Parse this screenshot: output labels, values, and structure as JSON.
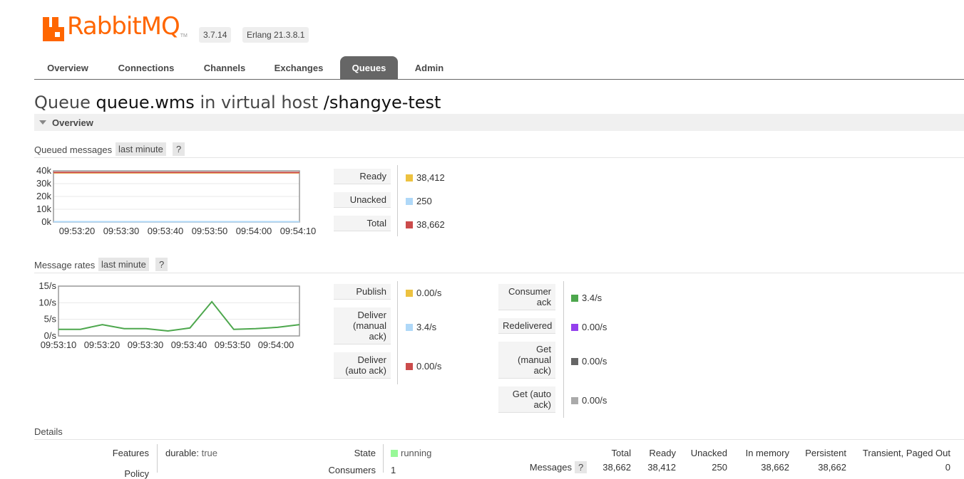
{
  "header": {
    "logo_text": "RabbitMQ",
    "logo_tm": "TM",
    "version": "3.7.14",
    "erlang": "Erlang 21.3.8.1"
  },
  "tabs": [
    {
      "label": "Overview",
      "active": false
    },
    {
      "label": "Connections",
      "active": false
    },
    {
      "label": "Channels",
      "active": false
    },
    {
      "label": "Exchanges",
      "active": false
    },
    {
      "label": "Queues",
      "active": true
    },
    {
      "label": "Admin",
      "active": false
    }
  ],
  "page": {
    "title_prefix": "Queue",
    "queue_name": "queue.wms",
    "title_mid": "in virtual host",
    "vhost": "/shangye-test",
    "section": "Overview"
  },
  "queued": {
    "title": "Queued messages",
    "range": "last minute",
    "help": "?",
    "legend": [
      {
        "label": "Ready",
        "value": "38,412",
        "color": "#edc240"
      },
      {
        "label": "Unacked",
        "value": "250",
        "color": "#afd8f8"
      },
      {
        "label": "Total",
        "value": "38,662",
        "color": "#cb4b4b"
      }
    ]
  },
  "rates": {
    "title": "Message rates",
    "range": "last minute",
    "help": "?",
    "legend_left": [
      {
        "label": "Publish",
        "value": "0.00/s",
        "color": "#edc240"
      },
      {
        "label": "Deliver (manual ack)",
        "value": "3.4/s",
        "color": "#afd8f8"
      },
      {
        "label": "Deliver (auto ack)",
        "value": "0.00/s",
        "color": "#cb4b4b"
      }
    ],
    "legend_right": [
      {
        "label": "Consumer ack",
        "value": "3.4/s",
        "color": "#4da74d"
      },
      {
        "label": "Redelivered",
        "value": "0.00/s",
        "color": "#9440ed"
      },
      {
        "label": "Get (manual ack)",
        "value": "0.00/s",
        "color": "#666666"
      },
      {
        "label": "Get (auto ack)",
        "value": "0.00/s",
        "color": "#aaaaaa"
      }
    ]
  },
  "chart_data": [
    {
      "type": "line",
      "yticks": [
        "40k",
        "30k",
        "20k",
        "10k",
        "0k"
      ],
      "ylim": [
        0,
        40000
      ],
      "xticks": [
        "09:53:20",
        "09:53:30",
        "09:53:40",
        "09:53:50",
        "09:54:00",
        "09:54:10"
      ],
      "series": [
        {
          "name": "Ready",
          "color": "#edc240",
          "values": [
            38412,
            38412,
            38412,
            38412,
            38412,
            38412,
            38412
          ]
        },
        {
          "name": "Unacked",
          "color": "#afd8f8",
          "values": [
            250,
            250,
            250,
            250,
            250,
            250,
            250
          ]
        },
        {
          "name": "Total",
          "color": "#cb4b4b",
          "values": [
            38800,
            38760,
            38740,
            38720,
            38700,
            38680,
            38662
          ]
        }
      ]
    },
    {
      "type": "line",
      "yticks": [
        "15/s",
        "10/s",
        "5/s",
        "0/s"
      ],
      "ylim": [
        0,
        15
      ],
      "xticks": [
        "09:53:10",
        "09:53:20",
        "09:53:30",
        "09:53:40",
        "09:53:50",
        "09:54:00"
      ],
      "series": [
        {
          "name": "Consumer ack",
          "color": "#4da74d",
          "values": [
            2.0,
            2.0,
            3.4,
            2.2,
            2.2,
            1.5,
            2.4,
            10.3,
            2.0,
            2.2,
            2.6,
            3.4
          ]
        }
      ]
    }
  ],
  "details": {
    "title": "Details",
    "features_label": "Features",
    "features_key": "durable:",
    "features_value": "true",
    "policy_label": "Policy",
    "state_label": "State",
    "state_value": "running",
    "state_color": "#98f898",
    "consumers_label": "Consumers",
    "consumers_value": "1",
    "messages_label": "Messages",
    "messages_help": "?",
    "columns": [
      "Total",
      "Ready",
      "Unacked",
      "In memory",
      "Persistent",
      "Transient, Paged Out"
    ],
    "values": [
      "38,662",
      "38,412",
      "250",
      "38,662",
      "38,662",
      "0"
    ]
  }
}
